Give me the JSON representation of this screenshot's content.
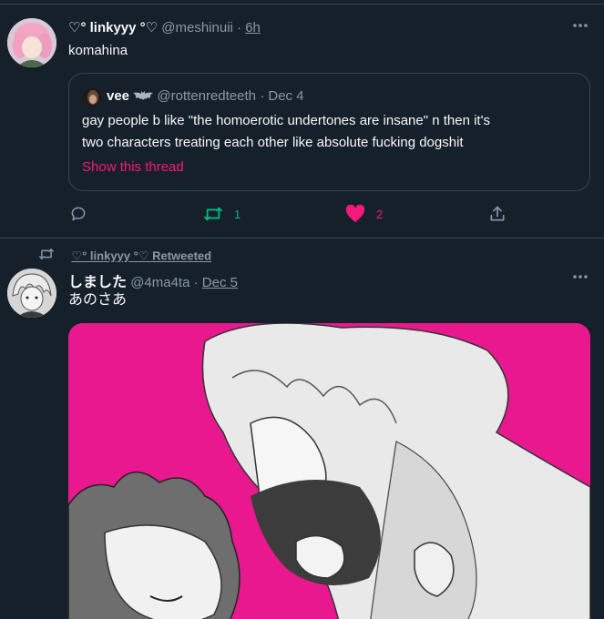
{
  "tweet1": {
    "display_name": "♡° linkyyy °♡",
    "handle": "@meshinuii",
    "time": "6h",
    "text": "komahina",
    "quote": {
      "display_name": "vee",
      "handle": "@rottenredteeth",
      "date": "Dec 4",
      "text_line1": "gay people b like  \"the homoerotic undertones are insane\"  n then it's",
      "text_line2": "two characters treating each other like absolute fucking dogshit",
      "show_thread": "Show this thread"
    },
    "retweets": "1",
    "likes": "2",
    "colors": {
      "retweet": "#00ba7c",
      "like": "#f91880"
    }
  },
  "tweet2": {
    "retweeted_by": "♡° linkyyy °♡ Retweeted",
    "display_name": "しました",
    "handle": "@4ma4ta",
    "date": "Dec 5",
    "text": "あのさあ",
    "media_accent": "#e8188f"
  },
  "icons": [
    "more-icon",
    "reply-icon",
    "retweet-icon",
    "like-icon",
    "share-icon",
    "bat-icon"
  ],
  "separator": "·"
}
